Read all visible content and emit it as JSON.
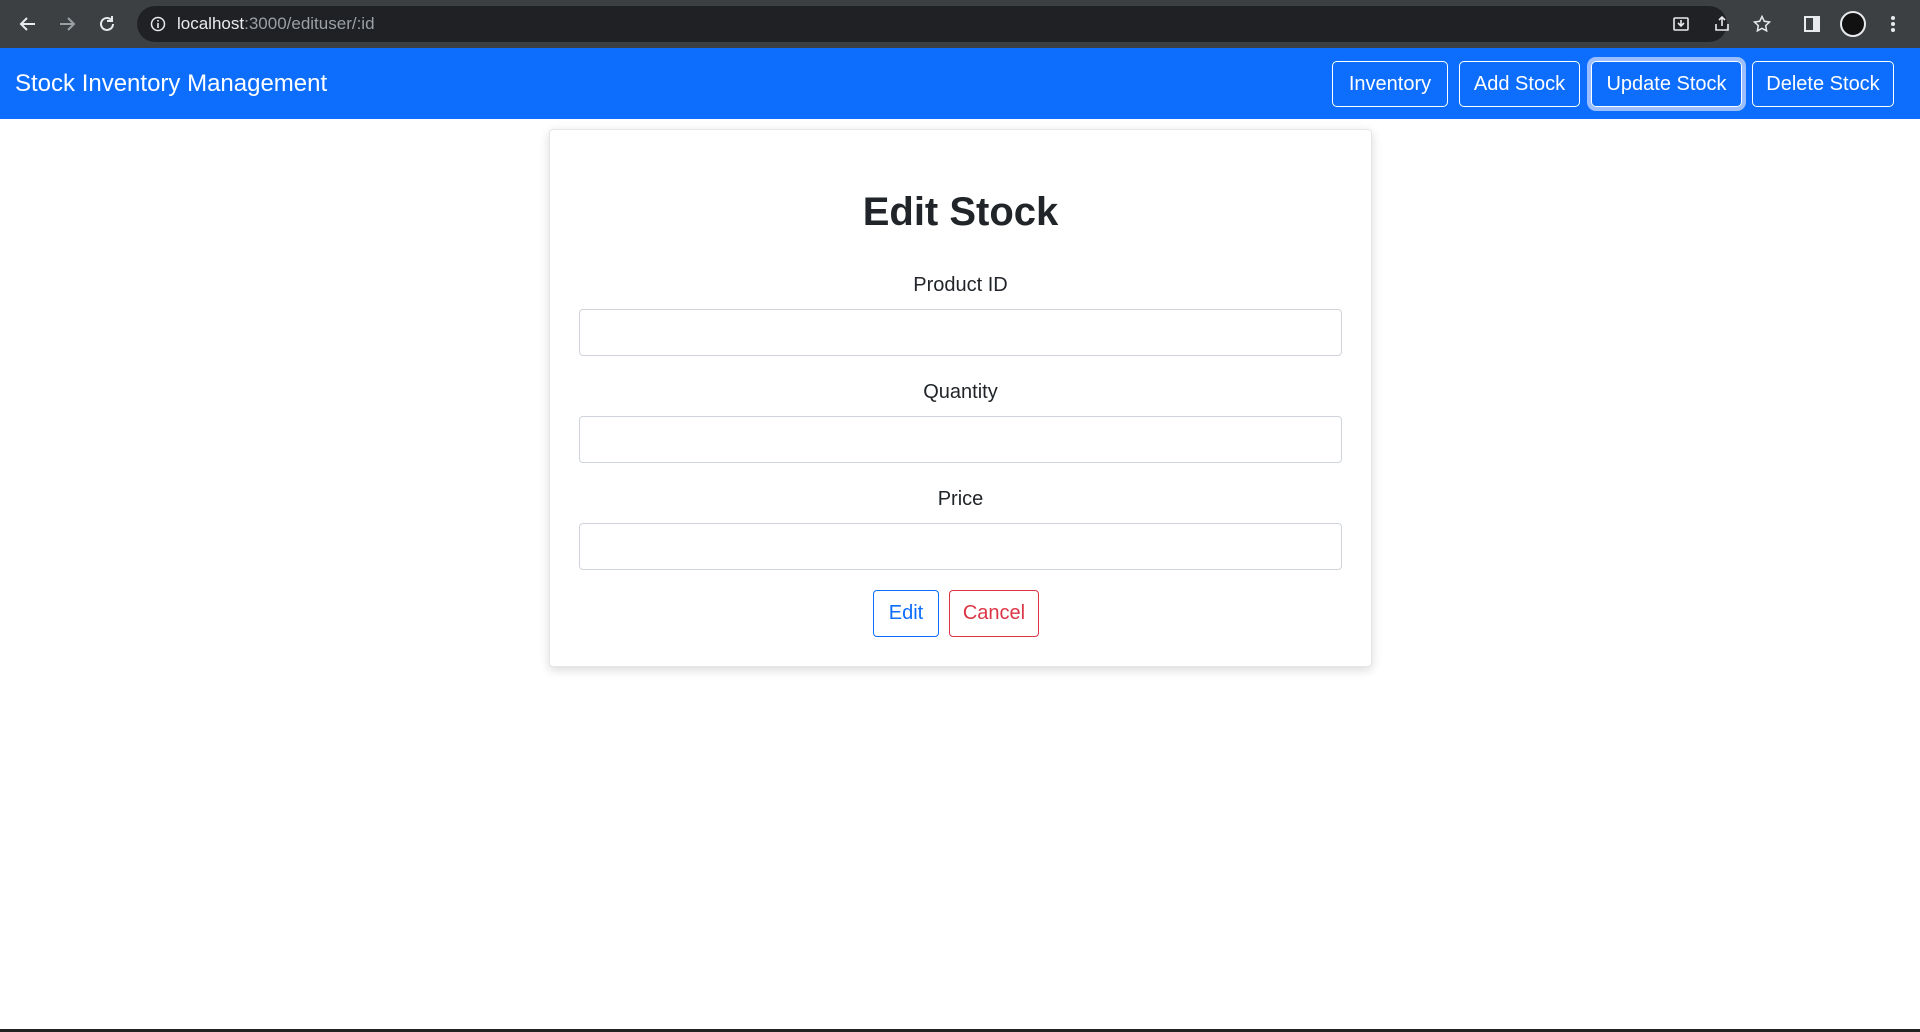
{
  "browser": {
    "url_host": "localhost",
    "url_rest": ":3000/edituser/:id",
    "icons": [
      "back-arrow-icon",
      "forward-arrow-icon",
      "reload-icon",
      "info-icon",
      "install-icon",
      "share-icon",
      "star-icon",
      "side-panel-icon",
      "profile-avatar",
      "more-vert-icon"
    ]
  },
  "navbar": {
    "brand": "Stock Inventory Management",
    "links": [
      {
        "label": "Inventory"
      },
      {
        "label": "Add Stock"
      },
      {
        "label": "Update Stock",
        "active": true
      },
      {
        "label": "Delete Stock"
      }
    ],
    "color": "#0d6efd"
  },
  "form": {
    "title": "Edit Stock",
    "fields": [
      {
        "label": "Product ID",
        "value": ""
      },
      {
        "label": "Quantity",
        "value": ""
      },
      {
        "label": "Price",
        "value": ""
      }
    ],
    "edit_label": "Edit",
    "cancel_label": "Cancel"
  },
  "colors": {
    "primary": "#0d6efd",
    "danger": "#dc3545",
    "chrome": "#3c4043"
  }
}
